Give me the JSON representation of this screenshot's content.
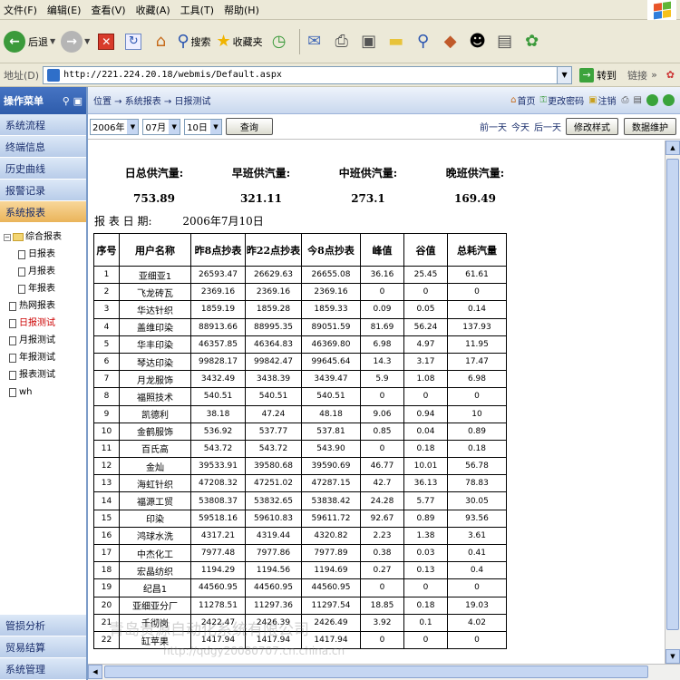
{
  "menu": [
    "文件(F)",
    "编辑(E)",
    "查看(V)",
    "收藏(A)",
    "工具(T)",
    "帮助(H)"
  ],
  "toolbar": {
    "back_label": "后退",
    "search_label": "搜索",
    "favorites_label": "收藏夹"
  },
  "address": {
    "label": "地址(D)",
    "url": "http://221.224.20.18/webmis/Default.aspx",
    "go_label": "转到",
    "links_label": "链接"
  },
  "left": {
    "header": "操作菜单",
    "sections": [
      "系统流程",
      "终端信息",
      "历史曲线",
      "报警记录",
      "系统报表"
    ],
    "tree": {
      "root": "综合报表",
      "children": [
        "日报表",
        "月报表",
        "年报表"
      ],
      "others": [
        "热网报表",
        "日报测试",
        "月报测试",
        "年报测试",
        "报表测试",
        "wh"
      ]
    },
    "bottom": [
      "管损分析",
      "贸易结算",
      "系统管理"
    ]
  },
  "right": {
    "breadcrumb": "位置 → 系统报表 → 日报测试",
    "actions": {
      "home": "首页",
      "change_password": "更改密码",
      "logout": "注销"
    },
    "controls": {
      "year": "2006年",
      "month": "07月",
      "day": "10日",
      "query": "查询",
      "prev_day": "前一天",
      "today": "今天",
      "next_day": "后一天",
      "modify_style": "修改样式",
      "data_maintenance": "数据维护"
    },
    "summary": {
      "labels": [
        "日总供汽量:",
        "早班供汽量:",
        "中班供汽量:",
        "晚班供汽量:"
      ],
      "values": [
        "753.89",
        "321.11",
        "273.1",
        "169.49"
      ]
    },
    "report_date_label": "报 表 日 期:",
    "report_date_value": "2006年7月10日",
    "table": {
      "headers": [
        "序号",
        "用户名称",
        "昨8点抄表",
        "昨22点抄表",
        "今8点抄表",
        "峰值",
        "谷值",
        "总耗汽量"
      ],
      "rows": [
        [
          "1",
          "亚细亚1",
          "26593.47",
          "26629.63",
          "26655.08",
          "36.16",
          "25.45",
          "61.61"
        ],
        [
          "2",
          "飞龙砖瓦",
          "2369.16",
          "2369.16",
          "2369.16",
          "0",
          "0",
          "0"
        ],
        [
          "3",
          "华达针织",
          "1859.19",
          "1859.28",
          "1859.33",
          "0.09",
          "0.05",
          "0.14"
        ],
        [
          "4",
          "盖维印染",
          "88913.66",
          "88995.35",
          "89051.59",
          "81.69",
          "56.24",
          "137.93"
        ],
        [
          "5",
          "华丰印染",
          "46357.85",
          "46364.83",
          "46369.80",
          "6.98",
          "4.97",
          "11.95"
        ],
        [
          "6",
          "琴达印染",
          "99828.17",
          "99842.47",
          "99645.64",
          "14.3",
          "3.17",
          "17.47"
        ],
        [
          "7",
          "月龙服饰",
          "3432.49",
          "3438.39",
          "3439.47",
          "5.9",
          "1.08",
          "6.98"
        ],
        [
          "8",
          "福照技术",
          "540.51",
          "540.51",
          "540.51",
          "0",
          "0",
          "0"
        ],
        [
          "9",
          "凯德利",
          "38.18",
          "47.24",
          "48.18",
          "9.06",
          "0.94",
          "10"
        ],
        [
          "10",
          "金鹤服饰",
          "536.92",
          "537.77",
          "537.81",
          "0.85",
          "0.04",
          "0.89"
        ],
        [
          "11",
          "百氏高",
          "543.72",
          "543.72",
          "543.90",
          "0",
          "0.18",
          "0.18"
        ],
        [
          "12",
          "金灿",
          "39533.91",
          "39580.68",
          "39590.69",
          "46.77",
          "10.01",
          "56.78"
        ],
        [
          "13",
          "海虹针织",
          "47208.32",
          "47251.02",
          "47287.15",
          "42.7",
          "36.13",
          "78.83"
        ],
        [
          "14",
          "福源工贸",
          "53808.37",
          "53832.65",
          "53838.42",
          "24.28",
          "5.77",
          "30.05"
        ],
        [
          "15",
          "印染",
          "59518.16",
          "59610.83",
          "59611.72",
          "92.67",
          "0.89",
          "93.56"
        ],
        [
          "16",
          "鸿球水洗",
          "4317.21",
          "4319.44",
          "4320.82",
          "2.23",
          "1.38",
          "3.61"
        ],
        [
          "17",
          "中杰化工",
          "7977.48",
          "7977.86",
          "7977.89",
          "0.38",
          "0.03",
          "0.41"
        ],
        [
          "18",
          "宏晶纺织",
          "1194.29",
          "1194.56",
          "1194.69",
          "0.27",
          "0.13",
          "0.4"
        ],
        [
          "19",
          "纪昌1",
          "44560.95",
          "44560.95",
          "44560.95",
          "0",
          "0",
          "0"
        ],
        [
          "20",
          "亚细亚分厂",
          "11278.51",
          "11297.36",
          "11297.54",
          "18.85",
          "0.18",
          "19.03"
        ],
        [
          "21",
          "千彻岗",
          "2422.47",
          "2426.39",
          "2426.49",
          "3.92",
          "0.1",
          "4.02"
        ],
        [
          "22",
          "缸苹果",
          "1417.94",
          "1417.94",
          "1417.94",
          "0",
          "0",
          "0"
        ]
      ]
    }
  },
  "watermark": "青岛贵源自动化系统有限公司",
  "watermark2": "http://qdgy20080707.cn.china.cn"
}
